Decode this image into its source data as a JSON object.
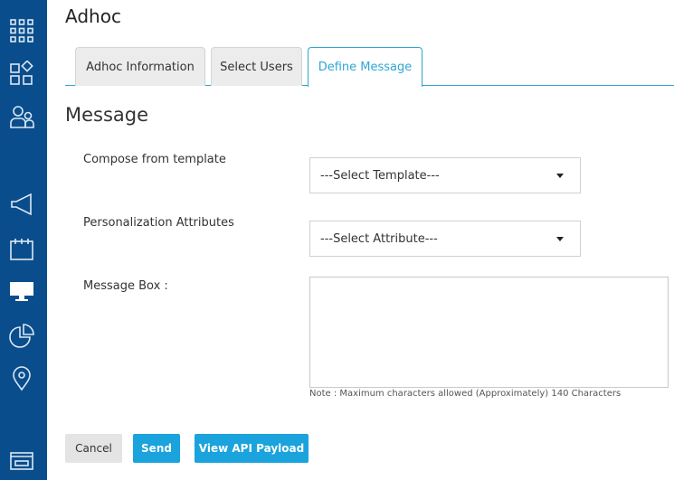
{
  "page": {
    "title": "Adhoc"
  },
  "sidebar": {
    "icons": [
      "apps-grid-icon",
      "dashboard-icon",
      "users-icon",
      "campaign-megaphone-icon",
      "calendar-icon",
      "monitor-icon",
      "pie-chart-icon",
      "location-pin-icon",
      "window-icon"
    ]
  },
  "tabs": [
    {
      "label": "Adhoc Information",
      "active": false
    },
    {
      "label": "Select Users",
      "active": false
    },
    {
      "label": "Define Message",
      "active": true
    }
  ],
  "message": {
    "heading": "Message",
    "template_label": "Compose from template",
    "template_value": "---Select Template---",
    "attribute_label": "Personalization Attributes",
    "attribute_value": "---Select Attribute---",
    "box_label": "Message Box :",
    "box_value": "",
    "note": "Note : Maximum characters allowed (Approximately) 140 Characters"
  },
  "buttons": {
    "cancel": "Cancel",
    "send": "Send",
    "view_api": "View API Payload"
  },
  "colors": {
    "sidebar": "#0a4d8c",
    "accent": "#1aa3dc",
    "tab_active": "#2fa6d6"
  }
}
